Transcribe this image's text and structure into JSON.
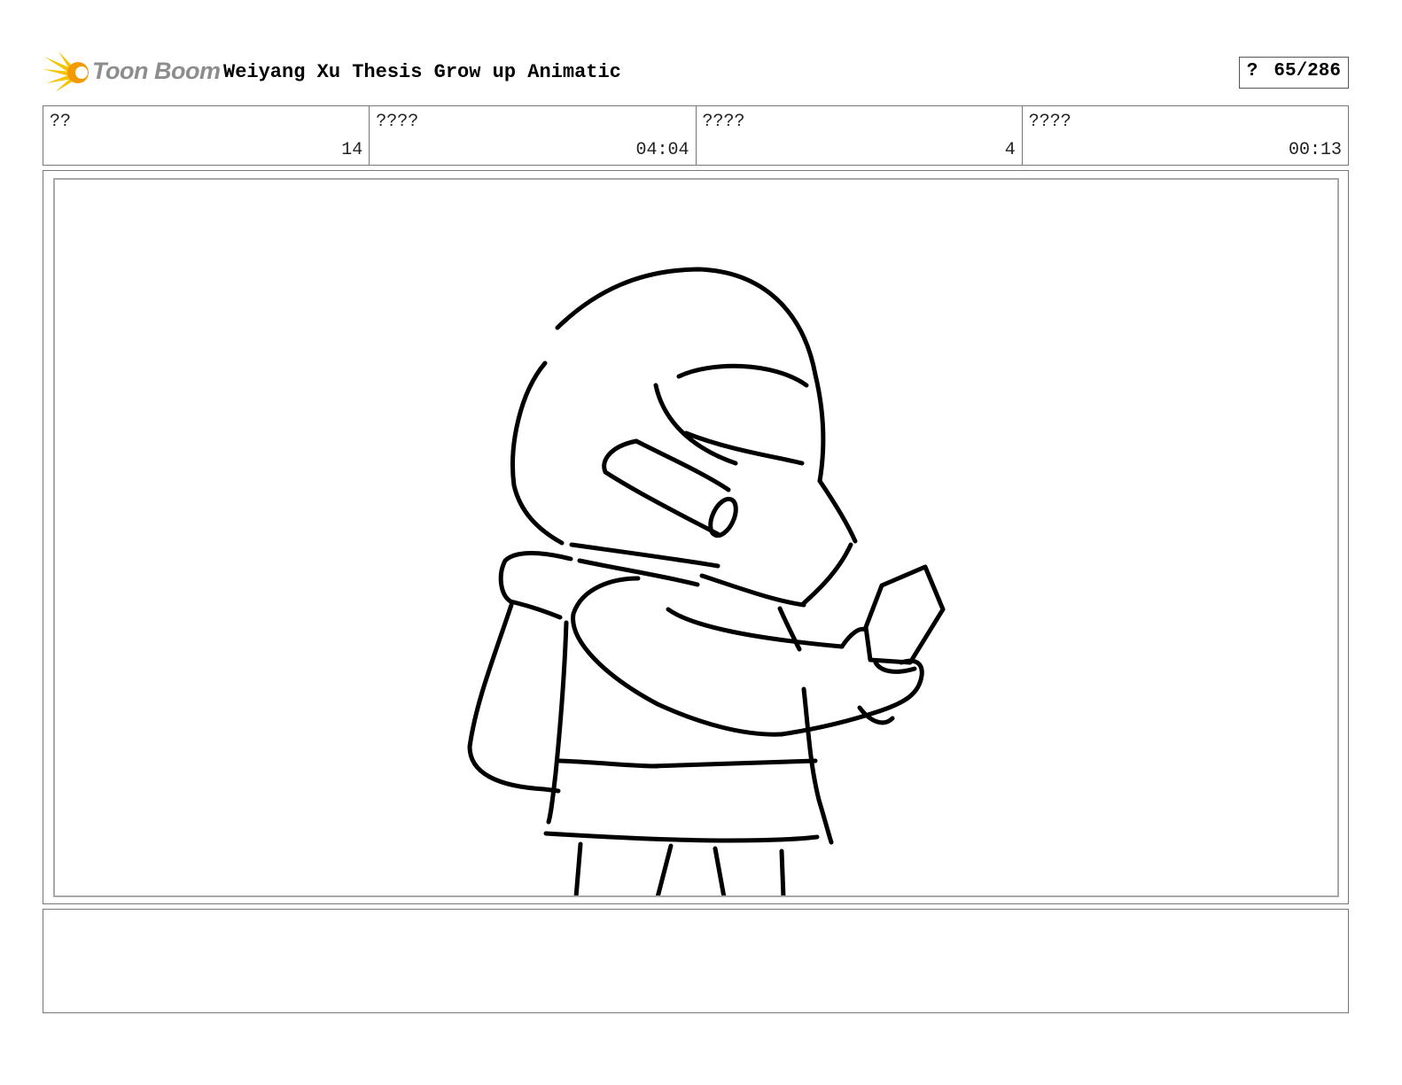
{
  "header": {
    "logo_text": "Toon Boom",
    "title": "Weiyang Xu Thesis Grow up Animatic",
    "page_prefix": "?",
    "page_counter": "65/286"
  },
  "info": [
    {
      "label": "??",
      "value": "14"
    },
    {
      "label": "????",
      "value": "04:04"
    },
    {
      "label": "????",
      "value": "4"
    },
    {
      "label": "????",
      "value": "00:13"
    }
  ],
  "notes": {
    "text": ""
  },
  "colors": {
    "logo_yellow": "#f5c400",
    "logo_orange": "#f39a00",
    "logo_text": "#8d8d8d",
    "ink": "#000000"
  }
}
